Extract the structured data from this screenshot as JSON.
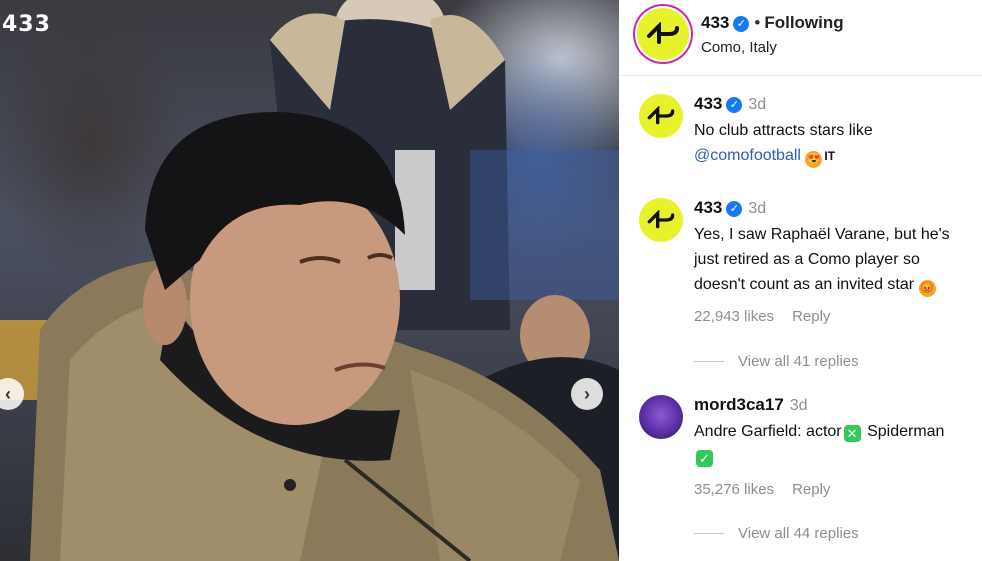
{
  "photo": {
    "watermark": "433",
    "prev_icon": "‹",
    "next_icon": "›"
  },
  "post_header": {
    "username": "433",
    "separator": "•",
    "follow_status": "Following",
    "location": "Como, Italy",
    "verified_icon": "✓"
  },
  "comments": [
    {
      "username": "433",
      "time": "3d",
      "text_line1": "No club attracts stars like",
      "mention": "@comofootball",
      "emoji": "😍",
      "flag_text": "IT"
    },
    {
      "username": "433",
      "time": "3d",
      "text_line1": "Yes, I saw Raphaël Varane, but he's",
      "text_line2": "just retired as a Como player so",
      "text_line3": "doesn't count as an invited star",
      "emoji": "😡",
      "likes": "22,943 likes",
      "reply_label": "Reply",
      "view_replies": "View all 41 replies"
    },
    {
      "username": "mord3ca17",
      "time": "3d",
      "text_line1_a": "Andre Garfield: actor",
      "check_icon": "✓",
      "text_line1_b": "Spiderman",
      "likes": "35,276 likes",
      "reply_label": "Reply",
      "view_replies": "View all 44 replies"
    }
  ],
  "colors": {
    "brand_yellow": "#e8f22a",
    "verified_blue": "#1877f2",
    "mention_blue": "#2b5fb8",
    "muted_gray": "#8e8e8e",
    "check_green": "#34c759"
  },
  "icons": {
    "header_avatar": "433-logo-icon",
    "verified": "verified-badge-icon",
    "prev": "chevron-left-icon",
    "next": "chevron-right-icon"
  }
}
